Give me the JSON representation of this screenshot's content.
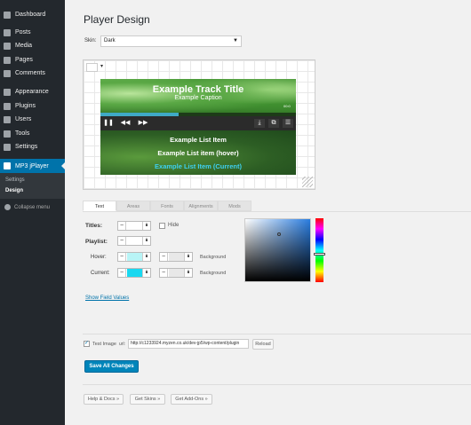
{
  "sidebar": {
    "items": [
      {
        "label": "Dashboard",
        "icon": "dashboard-icon"
      },
      {
        "label": "Posts",
        "icon": "pin-icon"
      },
      {
        "label": "Media",
        "icon": "media-icon"
      },
      {
        "label": "Pages",
        "icon": "page-icon"
      },
      {
        "label": "Comments",
        "icon": "comment-icon"
      },
      {
        "label": "Appearance",
        "icon": "brush-icon"
      },
      {
        "label": "Plugins",
        "icon": "plug-icon"
      },
      {
        "label": "Users",
        "icon": "user-icon"
      },
      {
        "label": "Tools",
        "icon": "wrench-icon"
      },
      {
        "label": "Settings",
        "icon": "settings-icon"
      },
      {
        "label": "MP3 jPlayer",
        "icon": "gear-icon"
      }
    ],
    "submenu": [
      "Settings",
      "Design"
    ],
    "collapse_label": "Collapse menu"
  },
  "page": {
    "title": "Player Design",
    "skin_label": "Skin:",
    "skin_value": "Dark"
  },
  "player": {
    "track_title": "Example Track Title",
    "caption": "Example Caption",
    "time": "00:0",
    "list": [
      "Example List Item",
      "Example List item (hover)",
      "Example List Item (Current)"
    ]
  },
  "tabs": [
    "Text",
    "Areas",
    "Fonts",
    "Alignments",
    "Mods"
  ],
  "fields": {
    "titles_label": "Titles:",
    "hide_label": "Hide",
    "playlist_label": "Playlist:",
    "hover_label": "Hover:",
    "current_label": "Current:",
    "background_label": "Background",
    "show_values": "Show Field Values"
  },
  "test_image": {
    "label": "Test Image",
    "url_label": "url:",
    "url_value": "http://c1233924.myzen.co.uk/dev-jp5/wp-content/plugin",
    "reload": "Reload"
  },
  "save_label": "Save All Changes",
  "footer_buttons": [
    "Help & Docs »",
    "Get Skins »",
    "Get Add-Ons »"
  ],
  "colors": {
    "accent": "#0073aa",
    "hover_bg": "#b8f4f6",
    "current_bg": "#19d8f0",
    "current_text": "#3ed0f0",
    "picker_color": "#2a7de0"
  }
}
